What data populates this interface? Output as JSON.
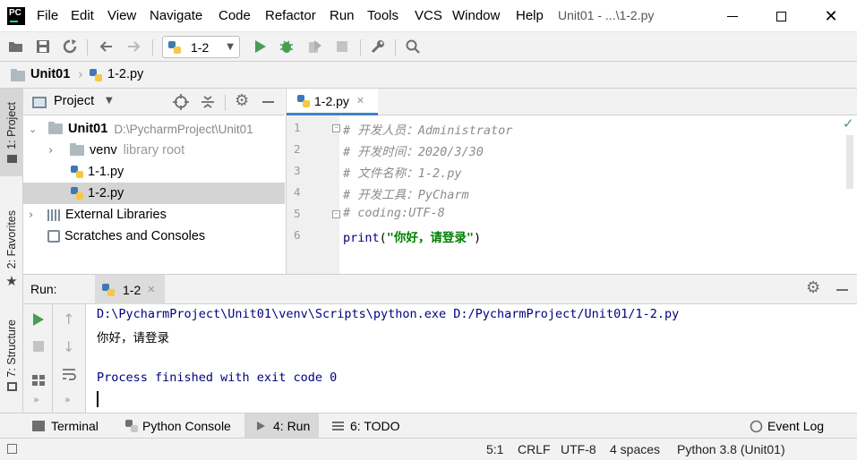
{
  "menu": {
    "items": [
      "File",
      "Edit",
      "View",
      "Navigate",
      "Code",
      "Refactor",
      "Run",
      "Tools",
      "VCS",
      "Window",
      "Help"
    ],
    "window_title": "Unit01 - ...\\1-2.py"
  },
  "toolbar": {
    "run_config": "1-2"
  },
  "breadcrumb": {
    "project": "Unit01",
    "file": "1-2.py"
  },
  "left_stripe": {
    "project_tab": "1: Project",
    "favorites_tab": "2: Favorites",
    "structure_tab": "7: Structure"
  },
  "project_panel": {
    "title": "Project",
    "root_name": "Unit01",
    "root_path": "D:\\PycharmProject\\Unit01",
    "venv_name": "venv",
    "venv_note": "library root",
    "file1": "1-1.py",
    "file2": "1-2.py",
    "external_libraries": "External Libraries",
    "scratches": "Scratches and Consoles"
  },
  "editor": {
    "tab_label": "1-2.py",
    "line_numbers": [
      "1",
      "2",
      "3",
      "4",
      "5",
      "6"
    ],
    "lines": [
      "# 开发人员：Administrator",
      "# 开发时间：2020/3/30",
      "# 文件名称：1-2.py",
      "# 开发工具：PyCharm",
      "# coding:UTF-8"
    ],
    "print_kw": "print",
    "print_open": "(",
    "print_str": "\"你好，请登录\"",
    "print_close": ")"
  },
  "run_panel": {
    "label": "Run:",
    "tab": "1-2",
    "console_lines": [
      "D:\\PycharmProject\\Unit01\\venv\\Scripts\\python.exe D:/PycharmProject/Unit01/1-2.py",
      "你好，请登录",
      "Process finished with exit code 0"
    ]
  },
  "bottom_tabs": {
    "terminal": "Terminal",
    "python_console": "Python Console",
    "run": "4: Run",
    "todo": "6: TODO",
    "event_log": "Event Log"
  },
  "status": {
    "position": "5:1",
    "line_sep": "CRLF",
    "encoding": "UTF-8",
    "indent": "4 spaces",
    "interpreter": "Python 3.8 (Unit01)"
  },
  "colors": {
    "accent": "#4083c9",
    "run_green": "#499c54",
    "comment_gray": "#8c8c8c",
    "string_green": "#008000",
    "console_blue": "#000080"
  }
}
